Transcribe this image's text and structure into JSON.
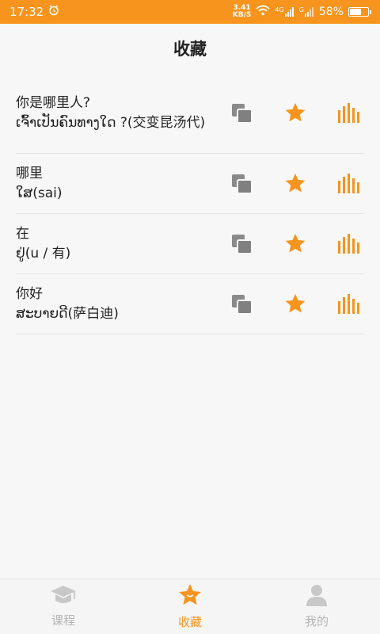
{
  "status_bar": {
    "time": "17:32",
    "speed_value": "3.41",
    "speed_unit": "KB/S",
    "network1": "4G",
    "network2": "G",
    "battery": "58%",
    "battery_level": 0.58
  },
  "header": {
    "title": "收藏"
  },
  "favorites": [
    {
      "chinese": "你是哪里人?",
      "lao": "ເຈົ້າເປັນຄົນທາງໃດ ?(交变昆汤代)"
    },
    {
      "chinese": "哪里",
      "lao": "ໃສ(sai)"
    },
    {
      "chinese": "在",
      "lao": "ຢູ່(u / 有)"
    },
    {
      "chinese": "你好",
      "lao": "ສະບາຍດີ(萨白迪)"
    }
  ],
  "tabs": [
    {
      "label": "课程",
      "icon": "graduation-cap-icon",
      "active": false
    },
    {
      "label": "收藏",
      "icon": "star-badge-icon",
      "active": true
    },
    {
      "label": "我的",
      "icon": "user-icon",
      "active": false
    }
  ],
  "colors": {
    "accent": "#f7941d",
    "icon_gray": "#808080",
    "inactive": "#c8c8c8"
  }
}
